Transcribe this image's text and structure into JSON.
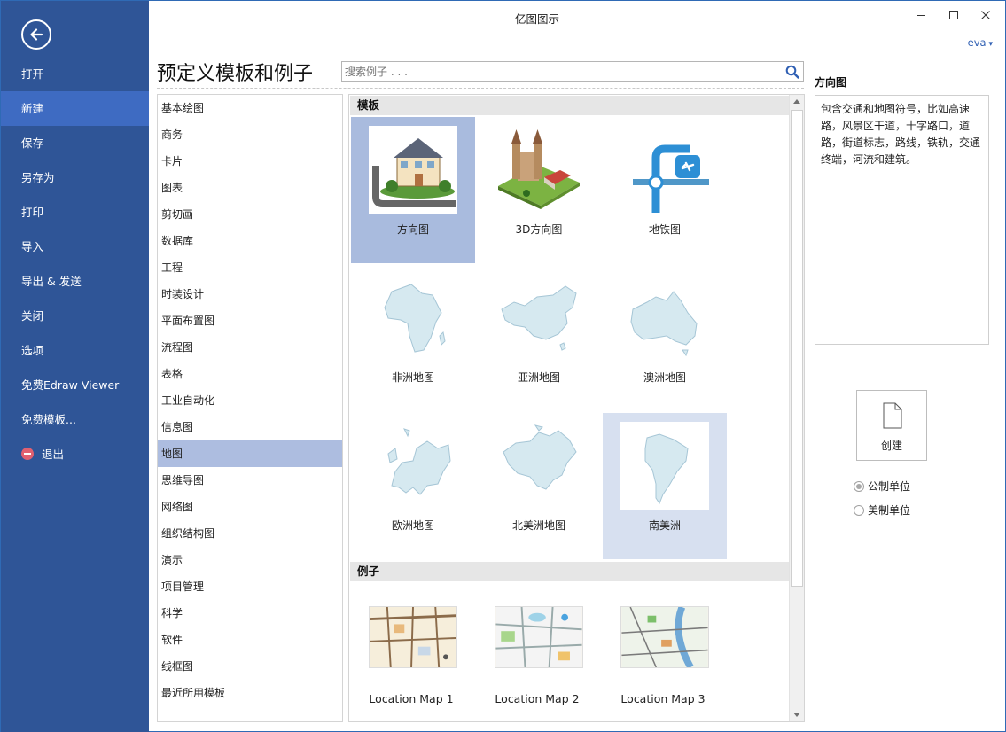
{
  "window": {
    "title": "亿图图示",
    "user": "eva"
  },
  "left_menu": [
    {
      "label": "打开"
    },
    {
      "label": "新建",
      "active": true
    },
    {
      "label": "保存"
    },
    {
      "label": "另存为"
    },
    {
      "label": "打印"
    },
    {
      "label": "导入"
    },
    {
      "label": "导出 & 发送"
    },
    {
      "label": "关闭"
    },
    {
      "label": "选项"
    },
    {
      "label": "免费Edraw Viewer"
    },
    {
      "label": "免费模板..."
    },
    {
      "label": "退出"
    }
  ],
  "page": {
    "title": "预定义模板和例子"
  },
  "search": {
    "placeholder": "搜索例子 . . ."
  },
  "categories": [
    "基本绘图",
    "商务",
    "卡片",
    "图表",
    "剪切画",
    "数据库",
    "工程",
    "时装设计",
    "平面布置图",
    "流程图",
    "表格",
    "工业自动化",
    "信息图",
    "地图",
    "思维导图",
    "网络图",
    "组织结构图",
    "演示",
    "项目管理",
    "科学",
    "软件",
    "线框图",
    "最近所用模板"
  ],
  "selected_category": "地图",
  "templates_header": "模板",
  "templates": [
    {
      "label": "方向图"
    },
    {
      "label": "3D方向图"
    },
    {
      "label": "地铁图"
    },
    {
      "label": "非洲地图"
    },
    {
      "label": "亚洲地图"
    },
    {
      "label": "澳洲地图"
    },
    {
      "label": "欧洲地图"
    },
    {
      "label": "北美洲地图"
    },
    {
      "label": "南美洲"
    }
  ],
  "examples_header": "例子",
  "examples": [
    {
      "label": "Location Map 1"
    },
    {
      "label": "Location Map 2"
    },
    {
      "label": "Location Map 3"
    }
  ],
  "preview": {
    "title": "方向图",
    "description": "包含交通和地图符号，比如高速路，风景区干道，十字路口，道路，街道标志，路线，铁轨，交通终端，河流和建筑。",
    "create_label": "创建"
  },
  "units": {
    "metric": "公制单位",
    "us": "美制单位",
    "selected": "metric"
  },
  "colors": {
    "sidebar": "#2f5597",
    "sidebar_active": "#3e6bc2",
    "selection": "#a9bbde",
    "map_fill": "#d6e9f0"
  }
}
